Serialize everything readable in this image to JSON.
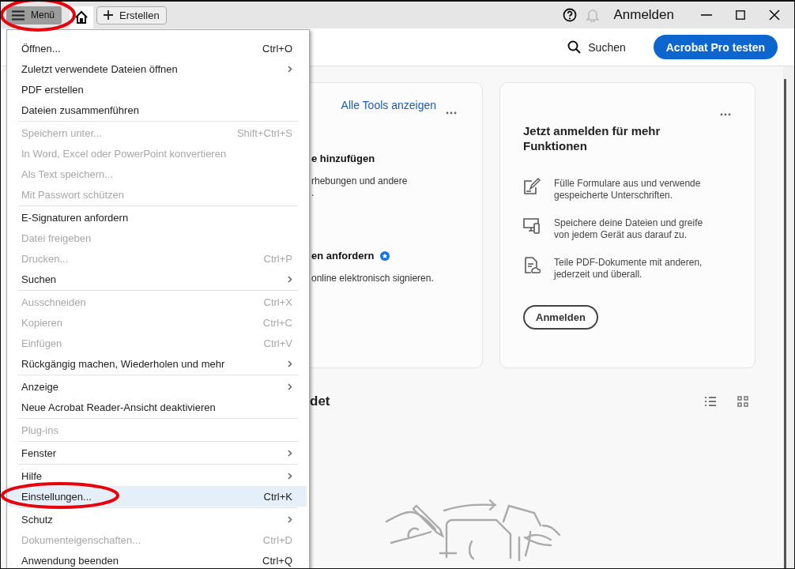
{
  "title_bar": {
    "menu_button": "Menü",
    "create_button": "Erstellen",
    "sign_in": "Anmelden"
  },
  "toolbar": {
    "search": "Suchen",
    "trial_button": "Acrobat Pro testen"
  },
  "tools_card": {
    "link": "Alle Tools anzeigen",
    "sections": [
      {
        "title": "e hinzufügen",
        "lines": [
          "rhebungen und andere",
          "."
        ],
        "badge": false
      },
      {
        "title": "en anfordern",
        "lines": [
          "online elektronisch signieren."
        ],
        "badge": true
      }
    ]
  },
  "signin_card": {
    "title": "Jetzt anmelden für mehr Funktionen",
    "features": [
      {
        "kind": "form",
        "text": "Fülle Formulare aus und verwende gespeicherte Unterschriften."
      },
      {
        "kind": "devices",
        "text": "Speichere deine Dateien und greife von jedem Gerät aus darauf zu."
      },
      {
        "kind": "share",
        "text": "Teile PDF-Dokumente mit anderen, jederzeit und überall."
      }
    ],
    "button": "Anmelden"
  },
  "recent": {
    "heading": "det",
    "views": [
      {
        "kind": "list"
      },
      {
        "kind": "grid"
      }
    ]
  },
  "menu": {
    "items": [
      {
        "kind": "item",
        "label": "Öffnen...",
        "shortcut": "Ctrl+O",
        "submenu": false,
        "disabled": false,
        "selected": false
      },
      {
        "kind": "item",
        "label": "Zuletzt verwendete Dateien öffnen",
        "submenu": true,
        "disabled": false,
        "selected": false
      },
      {
        "kind": "item",
        "label": "PDF erstellen",
        "submenu": false,
        "disabled": false,
        "selected": false
      },
      {
        "kind": "item",
        "label": "Dateien zusammenführen",
        "submenu": false,
        "disabled": false,
        "selected": false
      },
      {
        "kind": "separator"
      },
      {
        "kind": "item",
        "label": "Speichern unter...",
        "shortcut": "Shift+Ctrl+S",
        "submenu": false,
        "disabled": true,
        "selected": false
      },
      {
        "kind": "item",
        "label": "In Word, Excel oder PowerPoint konvertieren",
        "submenu": false,
        "disabled": true,
        "selected": false
      },
      {
        "kind": "item",
        "label": "Als Text speichern...",
        "submenu": false,
        "disabled": true,
        "selected": false
      },
      {
        "kind": "item",
        "label": "Mit Passwort schützen",
        "submenu": false,
        "disabled": true,
        "selected": false
      },
      {
        "kind": "separator"
      },
      {
        "kind": "item",
        "label": "E-Signaturen anfordern",
        "submenu": false,
        "disabled": false,
        "selected": false
      },
      {
        "kind": "item",
        "label": "Datei freigeben",
        "submenu": false,
        "disabled": true,
        "selected": false
      },
      {
        "kind": "item",
        "label": "Drucken...",
        "shortcut": "Ctrl+P",
        "submenu": false,
        "disabled": true,
        "selected": false
      },
      {
        "kind": "item",
        "label": "Suchen",
        "submenu": true,
        "disabled": false,
        "selected": false
      },
      {
        "kind": "separator"
      },
      {
        "kind": "item",
        "label": "Ausschneiden",
        "shortcut": "Ctrl+X",
        "submenu": false,
        "disabled": true,
        "selected": false
      },
      {
        "kind": "item",
        "label": "Kopieren",
        "shortcut": "Ctrl+C",
        "submenu": false,
        "disabled": true,
        "selected": false
      },
      {
        "kind": "item",
        "label": "Einfügen",
        "shortcut": "Ctrl+V",
        "submenu": false,
        "disabled": true,
        "selected": false
      },
      {
        "kind": "item",
        "label": "Rückgängig machen, Wiederholen und mehr",
        "submenu": true,
        "disabled": false,
        "selected": false
      },
      {
        "kind": "separator"
      },
      {
        "kind": "item",
        "label": "Anzeige",
        "submenu": true,
        "disabled": false,
        "selected": false
      },
      {
        "kind": "item",
        "label": "Neue Acrobat Reader-Ansicht deaktivieren",
        "submenu": false,
        "disabled": false,
        "selected": false
      },
      {
        "kind": "separator"
      },
      {
        "kind": "item",
        "label": "Plug-ins",
        "submenu": false,
        "disabled": true,
        "selected": false
      },
      {
        "kind": "separator"
      },
      {
        "kind": "item",
        "label": "Fenster",
        "submenu": true,
        "disabled": false,
        "selected": false
      },
      {
        "kind": "separator"
      },
      {
        "kind": "item",
        "label": "Hilfe",
        "submenu": true,
        "disabled": false,
        "selected": false
      },
      {
        "kind": "item",
        "label": "Einstellungen...",
        "shortcut": "Ctrl+K",
        "submenu": false,
        "disabled": false,
        "selected": true
      },
      {
        "kind": "separator"
      },
      {
        "kind": "item",
        "label": "Schutz",
        "submenu": true,
        "disabled": false,
        "selected": false
      },
      {
        "kind": "item",
        "label": "Dokumenteigenschaften...",
        "shortcut": "Ctrl+D",
        "submenu": false,
        "disabled": true,
        "selected": false
      },
      {
        "kind": "item",
        "label": "Anwendung beenden",
        "shortcut": "Ctrl+Q",
        "submenu": false,
        "disabled": false,
        "selected": false
      }
    ]
  }
}
